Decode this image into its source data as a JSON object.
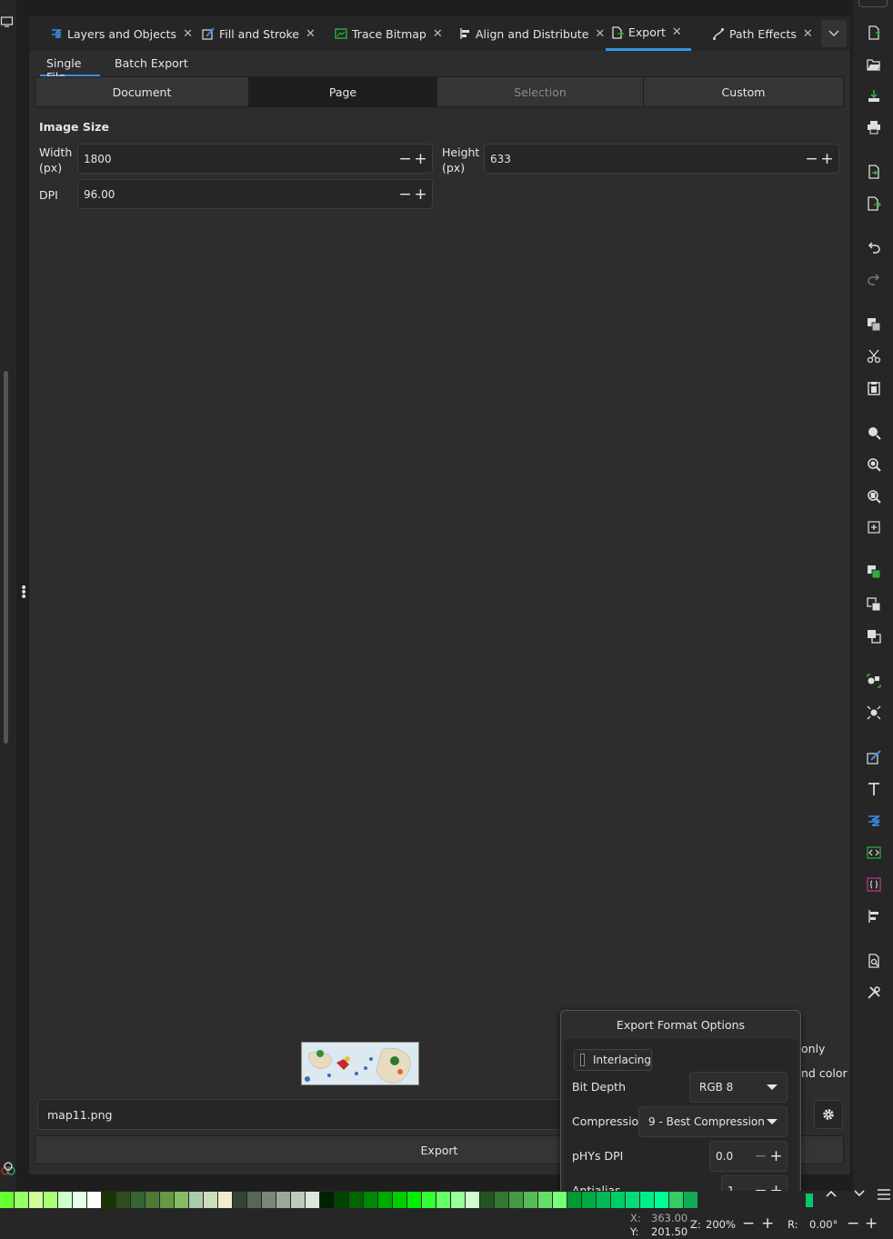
{
  "tabs": [
    {
      "label": "Layers and Objects",
      "icon": "layers-icon"
    },
    {
      "label": "Fill and Stroke",
      "icon": "fill-stroke-icon"
    },
    {
      "label": "Trace Bitmap",
      "icon": "trace-bitmap-icon"
    },
    {
      "label": "Align and Distribute",
      "icon": "align-icon"
    },
    {
      "label": "Export",
      "icon": "export-icon",
      "active": true
    },
    {
      "label": "Path Effects",
      "icon": "path-effects-icon"
    }
  ],
  "subtabs": [
    "Single File",
    "Batch Export"
  ],
  "area_buttons": [
    "Document",
    "Page",
    "Selection",
    "Custom"
  ],
  "image_size": {
    "title": "Image Size",
    "width_label": "Width\n(px)",
    "width_value": "1800",
    "height_label": "Height\n(px)",
    "height_value": "633",
    "dpi_label": "DPI",
    "dpi_value": "96.00"
  },
  "filename": "map11.png",
  "export_label": "Export",
  "hidden_options": {
    "only": "only",
    "color": "nd color"
  },
  "popover": {
    "title": "Export Format Options",
    "interlacing_label": "Interlacing",
    "interlacing_checked": false,
    "bit_depth_label": "Bit Depth",
    "bit_depth_value": "RGB 8",
    "compression_label": "Compression",
    "compression_value": "9 - Best Compression",
    "phys_dpi_label": "pHYs DPI",
    "phys_dpi_value": "0.0",
    "antialias_label": "Antialias",
    "antialias_value": "1"
  },
  "status": {
    "x_label": "X:",
    "x_value": "363.00",
    "y_label": "Y:",
    "y_value": "201.50",
    "zoom_label": "Z:",
    "zoom_value": "200%",
    "rotation_label": "R:",
    "rotation_value": "0.00°"
  },
  "colors": {
    "accent": "#3a8ee6",
    "panel": "#2d2d2d",
    "dark": "#1e1e1e"
  },
  "palette": [
    "#66ff33",
    "#99ff66",
    "#ccff99",
    "#aaff77",
    "#ccffcc",
    "#e6ffe6",
    "#ffffff",
    "#1a3300",
    "#2d4d1a",
    "#336633",
    "#4d7a33",
    "#669944",
    "#88bb66",
    "#aaccaa",
    "#ccddbb",
    "#eeeecc",
    "#334433",
    "#556655",
    "#778877",
    "#99aa99",
    "#bbccbb",
    "#dde6dd",
    "#002200",
    "#004400",
    "#006600",
    "#008800",
    "#00aa00",
    "#00cc00",
    "#00ee00",
    "#33ff33",
    "#66ff66",
    "#99ff99",
    "#ccffcc",
    "#225522",
    "#337733",
    "#449944",
    "#55bb55",
    "#66dd66",
    "#77ff77",
    "#009933",
    "#00aa44",
    "#00bb55",
    "#00cc66",
    "#00dd77",
    "#00ee88",
    "#00ff99",
    "#33cc66",
    "#11aa55"
  ]
}
